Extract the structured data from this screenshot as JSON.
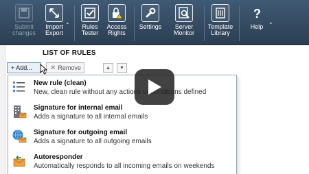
{
  "toolbar": {
    "submit": {
      "label1": "Submit",
      "label2": "changes",
      "icon": "save-icon"
    },
    "import_export": {
      "label1": "Import",
      "label2": "Export",
      "icon": "import-export-icon"
    },
    "rules_tester": {
      "label1": "Rules",
      "label2": "Tester",
      "icon": "rules-tester-icon"
    },
    "access_rights": {
      "label1": "Access",
      "label2": "Rights",
      "icon": "lock-warning-icon"
    },
    "settings": {
      "label": "Settings",
      "icon": "wrench-icon"
    },
    "server_monitor": {
      "label1": "Server",
      "label2": "Monitor",
      "icon": "server-monitor-icon"
    },
    "template_library": {
      "label1": "Template",
      "label2": "Library",
      "icon": "library-icon"
    },
    "help": {
      "label": "Help",
      "icon": "question-icon"
    }
  },
  "list": {
    "title": "LIST OF RULES",
    "add_label": "+ Add...",
    "remove_label": "Remove"
  },
  "menu": {
    "items": [
      {
        "title": "New rule (clean)",
        "desc": "New, clean rule without any actions or conditions defined",
        "icon": "list-icon"
      },
      {
        "title": "Signature for internal email",
        "desc": "Adds a signature to all internal emails",
        "icon": "building-mail-icon"
      },
      {
        "title": "Signature for outgoing email",
        "desc": "Adds a signature to all outgoing emails",
        "icon": "globe-mail-icon"
      },
      {
        "title": "Autoresponder",
        "desc": "Automatically responds to all incoming emails on weekends",
        "icon": "reply-mail-icon"
      }
    ]
  },
  "colors": {
    "toolbar_bg": "#34495f",
    "accent": "#3d7fc1",
    "play_overlay": "#212121"
  }
}
